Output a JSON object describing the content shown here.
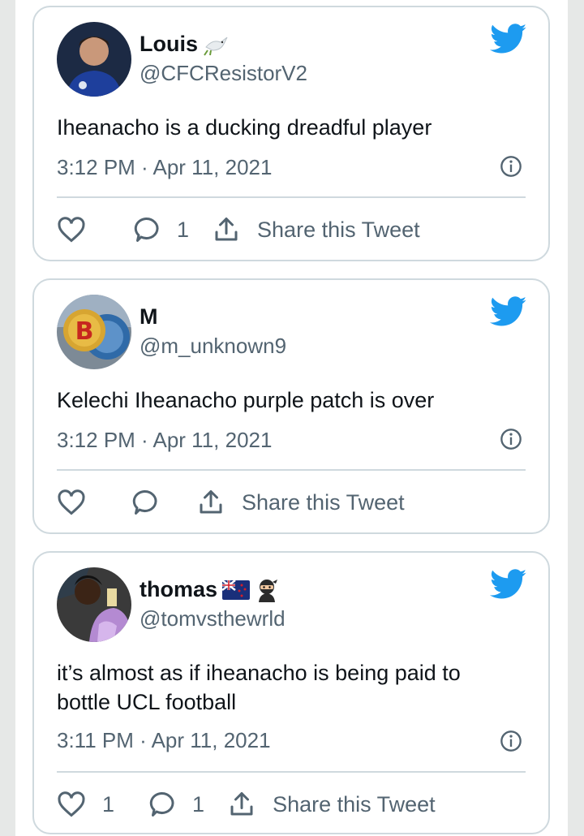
{
  "colors": {
    "twitter_blue": "#1d9bf0",
    "border": "#cfd9de",
    "secondary_text": "#536471",
    "primary_text": "#0f1419"
  },
  "tweets": [
    {
      "name": "Louis",
      "name_emoji": [
        "dove-emoji"
      ],
      "handle": "@CFCResistorV2",
      "text": "Iheanacho is a ducking dreadful player",
      "timestamp": "3:12 PM · Apr 11, 2021",
      "likes": "",
      "replies": "1",
      "share_label": "Share this Tweet"
    },
    {
      "name": "M",
      "name_emoji": [],
      "handle": "@m_unknown9",
      "text": "Kelechi Iheanacho purple patch is over",
      "timestamp": "3:12 PM · Apr 11, 2021",
      "likes": "",
      "replies": "",
      "share_label": "Share this Tweet"
    },
    {
      "name": "thomas",
      "name_emoji": [
        "new-zealand-flag-emoji",
        "ninja-emoji"
      ],
      "handle": "@tomvsthewrld",
      "text": "it’s almost as if iheanacho is being paid to bottle UCL football",
      "timestamp": "3:11 PM · Apr 11, 2021",
      "likes": "1",
      "replies": "1",
      "share_label": "Share this Tweet"
    }
  ]
}
